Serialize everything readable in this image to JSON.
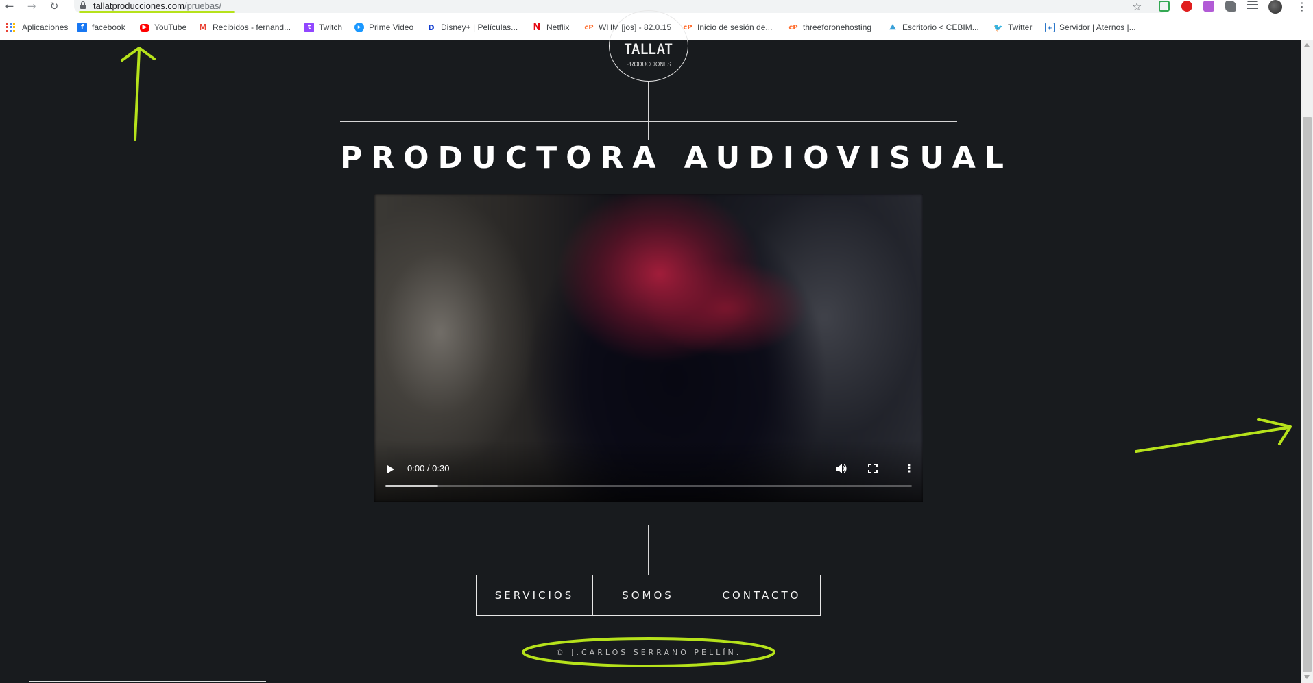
{
  "browser": {
    "url_host": "tallatproducciones.com",
    "url_path": "/pruebas/",
    "icons": {
      "back": "arrow-left-icon",
      "forward": "arrow-right-icon",
      "reload": "reload-icon",
      "lock": "lock-icon",
      "star": "star-icon",
      "menu": "kebab-icon"
    },
    "bookmarks": [
      {
        "label": "Aplicaciones",
        "icon": "apps-grid-icon"
      },
      {
        "label": "facebook",
        "icon": "facebook-icon",
        "color": "#1877f2"
      },
      {
        "label": "YouTube",
        "icon": "youtube-icon",
        "color": "#ff0000"
      },
      {
        "label": "Recibidos - fernand...",
        "icon": "gmail-icon",
        "color": "#ea4335"
      },
      {
        "label": "Twitch",
        "icon": "twitch-icon",
        "color": "#9146ff"
      },
      {
        "label": "Prime Video",
        "icon": "prime-video-icon",
        "color": "#1a98ff"
      },
      {
        "label": "Disney+ | Películas...",
        "icon": "disney-plus-icon",
        "color": "#113ccf"
      },
      {
        "label": "Netflix",
        "icon": "netflix-icon",
        "color": "#e50914"
      },
      {
        "label": "WHM [jos] - 82.0.15",
        "icon": "cpanel-icon",
        "color": "#ff6c2c"
      },
      {
        "label": "Inicio de sesión de...",
        "icon": "cpanel-icon",
        "color": "#ff6c2c"
      },
      {
        "label": "threeforonehosting",
        "icon": "cpanel-icon",
        "color": "#ff6c2c"
      },
      {
        "label": "Escritorio < CEBIM...",
        "icon": "site-icon",
        "color": "#3aa0d8"
      },
      {
        "label": "Twitter",
        "icon": "twitter-icon",
        "color": "#1da1f2"
      },
      {
        "label": "Servidor | Aternos |...",
        "icon": "aternos-icon",
        "color": "#2a76c9"
      }
    ]
  },
  "page": {
    "logo_title": "TALLAT",
    "logo_subtitle": "PRODUCCIONES",
    "title": "PRODUCTORA AUDIOVISUAL",
    "video": {
      "time": "0:00 / 0:30",
      "progress": 0,
      "buffered": 0.1
    },
    "nav": [
      "SERVICIOS",
      "SOMOS",
      "CONTACTO"
    ],
    "copyright": "© J.CARLOS SERRANO PELLÍN."
  },
  "colors": {
    "background": "#181b1e",
    "annotation": "#b6e21b",
    "text": "#ffffff"
  }
}
